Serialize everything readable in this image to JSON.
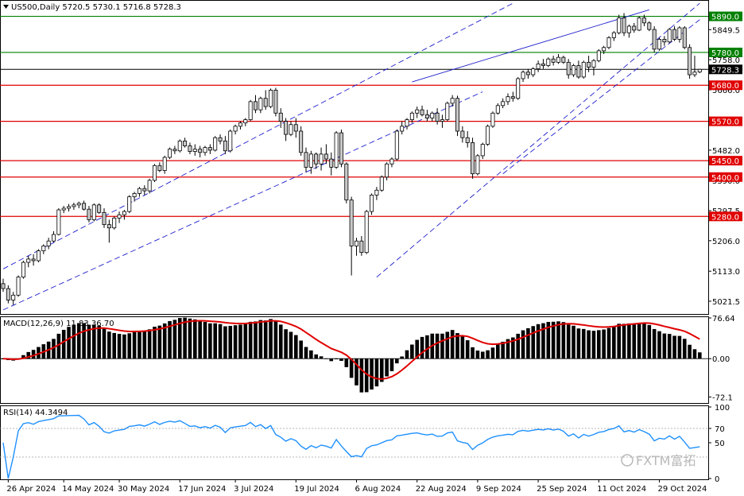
{
  "symbol_header": "US500,Daily  5720.5 5730.1 5716.8 5728.3",
  "macd_header": "MACD(12,26,9) 11.83 36.70",
  "rsi_header": "RSI(14) 44.3494",
  "watermark": "FXTM富拓",
  "colors": {
    "resistance_line": "#e00000",
    "level_green": "#008000",
    "current_price_line": "#000000",
    "channel": "#1f1fcc",
    "signal_line": "#e00000",
    "rsi_line": "#1e90ff",
    "candle_up_fill": "#ffffff",
    "candle_down_fill": "#c8c8c8",
    "candle_border": "#000000"
  },
  "chart_data": [
    {
      "type": "candlestick",
      "ylim": [
        4985,
        5935
      ],
      "y_ticks": [
        5849.5,
        5758.0,
        5666.0,
        5574.0,
        5482.0,
        5390.0,
        5297.5,
        5206.0,
        5113.0,
        5021.5
      ],
      "current_price": {
        "value": 5728.3,
        "label": "5728.3"
      },
      "horizontal_levels": [
        {
          "value": 5890.0,
          "label": "5890.0",
          "color": "green"
        },
        {
          "value": 5780.0,
          "label": "5780.0",
          "color": "green"
        },
        {
          "value": 5680.0,
          "label": "5680.0",
          "color": "red"
        },
        {
          "value": 5570.0,
          "label": "5570.0",
          "color": "red"
        },
        {
          "value": 5450.0,
          "label": "5450.0",
          "color": "red"
        },
        {
          "value": 5400.0,
          "label": "5400.0",
          "color": "red"
        },
        {
          "value": 5280.0,
          "label": "5280.0",
          "color": "red"
        }
      ],
      "channel_lines": [
        {
          "style": "dashed",
          "points": [
            [
              0,
              5120
            ],
            [
              101,
              5930
            ]
          ]
        },
        {
          "style": "dashed",
          "points": [
            [
              0,
              4995
            ],
            [
              95,
              5660
            ]
          ]
        },
        {
          "style": "dashed",
          "points": [
            [
              74,
              5095
            ],
            [
              138,
              5930
            ]
          ]
        },
        {
          "style": "dashed",
          "points": [
            [
              99,
              5410
            ],
            [
              138,
              5880
            ]
          ]
        },
        {
          "style": "solid",
          "points": [
            [
              81,
              5690
            ],
            [
              128,
              5910
            ]
          ]
        }
      ],
      "x_labels": [
        {
          "index": 1,
          "label": "26 Apr 2024"
        },
        {
          "index": 12,
          "label": "14 May 2024"
        },
        {
          "index": 23,
          "label": "30 May 2024"
        },
        {
          "index": 35,
          "label": "17 Jun 2024"
        },
        {
          "index": 46,
          "label": "3 Jul 2024"
        },
        {
          "index": 58,
          "label": "19 Jul 2024"
        },
        {
          "index": 70,
          "label": "6 Aug 2024"
        },
        {
          "index": 82,
          "label": "22 Aug 2024"
        },
        {
          "index": 94,
          "label": "9 Sep 2024"
        },
        {
          "index": 106,
          "label": "25 Sep 2024"
        },
        {
          "index": 118,
          "label": "11 Oct 2024"
        },
        {
          "index": 130,
          "label": "29 Oct 2024"
        }
      ],
      "candles": [
        [
          5075,
          5090,
          5050,
          5060
        ],
        [
          5060,
          5070,
          5015,
          5025
        ],
        [
          5025,
          5050,
          5010,
          5040
        ],
        [
          5040,
          5100,
          5035,
          5095
        ],
        [
          5095,
          5145,
          5090,
          5140
        ],
        [
          5140,
          5160,
          5125,
          5150
        ],
        [
          5150,
          5165,
          5130,
          5145
        ],
        [
          5145,
          5180,
          5140,
          5175
        ],
        [
          5175,
          5195,
          5165,
          5190
        ],
        [
          5190,
          5215,
          5180,
          5205
        ],
        [
          5205,
          5235,
          5200,
          5225
        ],
        [
          5225,
          5305,
          5222,
          5300
        ],
        [
          5300,
          5312,
          5290,
          5305
        ],
        [
          5305,
          5318,
          5295,
          5310
        ],
        [
          5310,
          5322,
          5300,
          5315
        ],
        [
          5315,
          5325,
          5305,
          5320
        ],
        [
          5320,
          5328,
          5298,
          5302
        ],
        [
          5302,
          5312,
          5262,
          5270
        ],
        [
          5270,
          5320,
          5265,
          5315
        ],
        [
          5315,
          5320,
          5288,
          5292
        ],
        [
          5292,
          5305,
          5245,
          5255
        ],
        [
          5255,
          5270,
          5200,
          5245
        ],
        [
          5245,
          5280,
          5240,
          5275
        ],
        [
          5275,
          5295,
          5260,
          5285
        ],
        [
          5285,
          5300,
          5270,
          5295
        ],
        [
          5295,
          5345,
          5290,
          5340
        ],
        [
          5340,
          5355,
          5325,
          5350
        ],
        [
          5350,
          5370,
          5340,
          5365
        ],
        [
          5365,
          5375,
          5345,
          5358
        ],
        [
          5358,
          5395,
          5350,
          5390
        ],
        [
          5390,
          5440,
          5385,
          5435
        ],
        [
          5435,
          5445,
          5415,
          5420
        ],
        [
          5420,
          5465,
          5410,
          5460
        ],
        [
          5460,
          5490,
          5455,
          5485
        ],
        [
          5485,
          5495,
          5470,
          5480
        ],
        [
          5480,
          5515,
          5475,
          5510
        ],
        [
          5510,
          5520,
          5490,
          5495
        ],
        [
          5495,
          5505,
          5470,
          5478
        ],
        [
          5478,
          5500,
          5465,
          5485
        ],
        [
          5485,
          5495,
          5460,
          5475
        ],
        [
          5475,
          5495,
          5465,
          5490
        ],
        [
          5490,
          5500,
          5470,
          5482
        ],
        [
          5482,
          5525,
          5478,
          5520
        ],
        [
          5520,
          5530,
          5500,
          5510
        ],
        [
          5510,
          5525,
          5470,
          5480
        ],
        [
          5480,
          5545,
          5475,
          5540
        ],
        [
          5540,
          5560,
          5530,
          5555
        ],
        [
          5555,
          5570,
          5545,
          5565
        ],
        [
          5565,
          5580,
          5555,
          5575
        ],
        [
          5575,
          5635,
          5570,
          5630
        ],
        [
          5630,
          5650,
          5595,
          5605
        ],
        [
          5605,
          5645,
          5595,
          5640
        ],
        [
          5640,
          5665,
          5605,
          5615
        ],
        [
          5615,
          5670,
          5610,
          5665
        ],
        [
          5665,
          5672,
          5585,
          5595
        ],
        [
          5595,
          5610,
          5550,
          5570
        ],
        [
          5570,
          5580,
          5510,
          5530
        ],
        [
          5530,
          5570,
          5525,
          5560
        ],
        [
          5560,
          5580,
          5520,
          5540
        ],
        [
          5540,
          5555,
          5465,
          5475
        ],
        [
          5475,
          5490,
          5415,
          5430
        ],
        [
          5430,
          5480,
          5410,
          5470
        ],
        [
          5470,
          5475,
          5425,
          5440
        ],
        [
          5440,
          5490,
          5420,
          5470
        ],
        [
          5470,
          5500,
          5440,
          5455
        ],
        [
          5455,
          5475,
          5405,
          5430
        ],
        [
          5430,
          5540,
          5425,
          5535
        ],
        [
          5535,
          5545,
          5430,
          5440
        ],
        [
          5440,
          5445,
          5320,
          5330
        ],
        [
          5330,
          5340,
          5100,
          5190
        ],
        [
          5190,
          5215,
          5160,
          5205
        ],
        [
          5205,
          5220,
          5160,
          5170
        ],
        [
          5170,
          5300,
          5165,
          5295
        ],
        [
          5295,
          5350,
          5285,
          5345
        ],
        [
          5345,
          5370,
          5330,
          5360
        ],
        [
          5360,
          5405,
          5355,
          5400
        ],
        [
          5400,
          5445,
          5390,
          5440
        ],
        [
          5440,
          5460,
          5430,
          5455
        ],
        [
          5455,
          5545,
          5450,
          5540
        ],
        [
          5540,
          5570,
          5530,
          5555
        ],
        [
          5555,
          5580,
          5545,
          5575
        ],
        [
          5575,
          5600,
          5565,
          5595
        ],
        [
          5595,
          5615,
          5580,
          5605
        ],
        [
          5605,
          5618,
          5585,
          5590
        ],
        [
          5590,
          5605,
          5570,
          5580
        ],
        [
          5580,
          5600,
          5570,
          5595
        ],
        [
          5595,
          5610,
          5560,
          5570
        ],
        [
          5570,
          5590,
          5550,
          5575
        ],
        [
          5575,
          5630,
          5570,
          5625
        ],
        [
          5625,
          5650,
          5615,
          5640
        ],
        [
          5640,
          5648,
          5525,
          5540
        ],
        [
          5540,
          5555,
          5505,
          5520
        ],
        [
          5520,
          5540,
          5490,
          5505
        ],
        [
          5505,
          5520,
          5395,
          5410
        ],
        [
          5410,
          5470,
          5405,
          5465
        ],
        [
          5465,
          5505,
          5455,
          5500
        ],
        [
          5500,
          5560,
          5495,
          5555
        ],
        [
          5555,
          5600,
          5550,
          5595
        ],
        [
          5595,
          5625,
          5590,
          5618
        ],
        [
          5618,
          5640,
          5610,
          5630
        ],
        [
          5630,
          5655,
          5620,
          5645
        ],
        [
          5645,
          5660,
          5630,
          5640
        ],
        [
          5640,
          5705,
          5635,
          5700
        ],
        [
          5700,
          5725,
          5690,
          5720
        ],
        [
          5720,
          5730,
          5700,
          5712
        ],
        [
          5712,
          5735,
          5705,
          5730
        ],
        [
          5730,
          5755,
          5720,
          5745
        ],
        [
          5745,
          5760,
          5730,
          5740
        ],
        [
          5740,
          5765,
          5735,
          5760
        ],
        [
          5760,
          5770,
          5740,
          5750
        ],
        [
          5750,
          5775,
          5745,
          5765
        ],
        [
          5765,
          5770,
          5745,
          5750
        ],
        [
          5750,
          5760,
          5700,
          5712
        ],
        [
          5712,
          5745,
          5705,
          5740
        ],
        [
          5740,
          5755,
          5700,
          5705
        ],
        [
          5705,
          5755,
          5700,
          5750
        ],
        [
          5750,
          5770,
          5720,
          5735
        ],
        [
          5735,
          5760,
          5710,
          5755
        ],
        [
          5755,
          5790,
          5750,
          5785
        ],
        [
          5785,
          5800,
          5775,
          5795
        ],
        [
          5795,
          5830,
          5790,
          5825
        ],
        [
          5825,
          5845,
          5815,
          5840
        ],
        [
          5840,
          5895,
          5835,
          5885
        ],
        [
          5885,
          5900,
          5830,
          5840
        ],
        [
          5840,
          5865,
          5825,
          5860
        ],
        [
          5860,
          5870,
          5840,
          5848
        ],
        [
          5848,
          5890,
          5845,
          5885
        ],
        [
          5885,
          5895,
          5860,
          5870
        ],
        [
          5870,
          5875,
          5845,
          5850
        ],
        [
          5850,
          5860,
          5780,
          5790
        ],
        [
          5790,
          5825,
          5785,
          5820
        ],
        [
          5820,
          5830,
          5800,
          5812
        ],
        [
          5812,
          5855,
          5808,
          5850
        ],
        [
          5850,
          5860,
          5815,
          5820
        ],
        [
          5820,
          5860,
          5810,
          5855
        ],
        [
          5855,
          5860,
          5790,
          5795
        ],
        [
          5795,
          5805,
          5700,
          5712
        ],
        [
          5712,
          5770,
          5705,
          5720
        ],
        [
          5720.5,
          5730.1,
          5716.8,
          5728.3
        ]
      ]
    },
    {
      "type": "bar",
      "indicator": "MACD(12,26,9)",
      "ylim": [
        -82,
        76.64
      ],
      "y_ticks": [
        76.64,
        0.0,
        -72.1
      ],
      "macd": 11.83,
      "signal": 36.7
    },
    {
      "type": "line",
      "indicator": "RSI(14)",
      "ylim": [
        0,
        100
      ],
      "y_ticks": [
        100,
        70,
        50,
        0
      ],
      "levels": [
        70,
        30
      ],
      "last": 44.3494
    }
  ]
}
